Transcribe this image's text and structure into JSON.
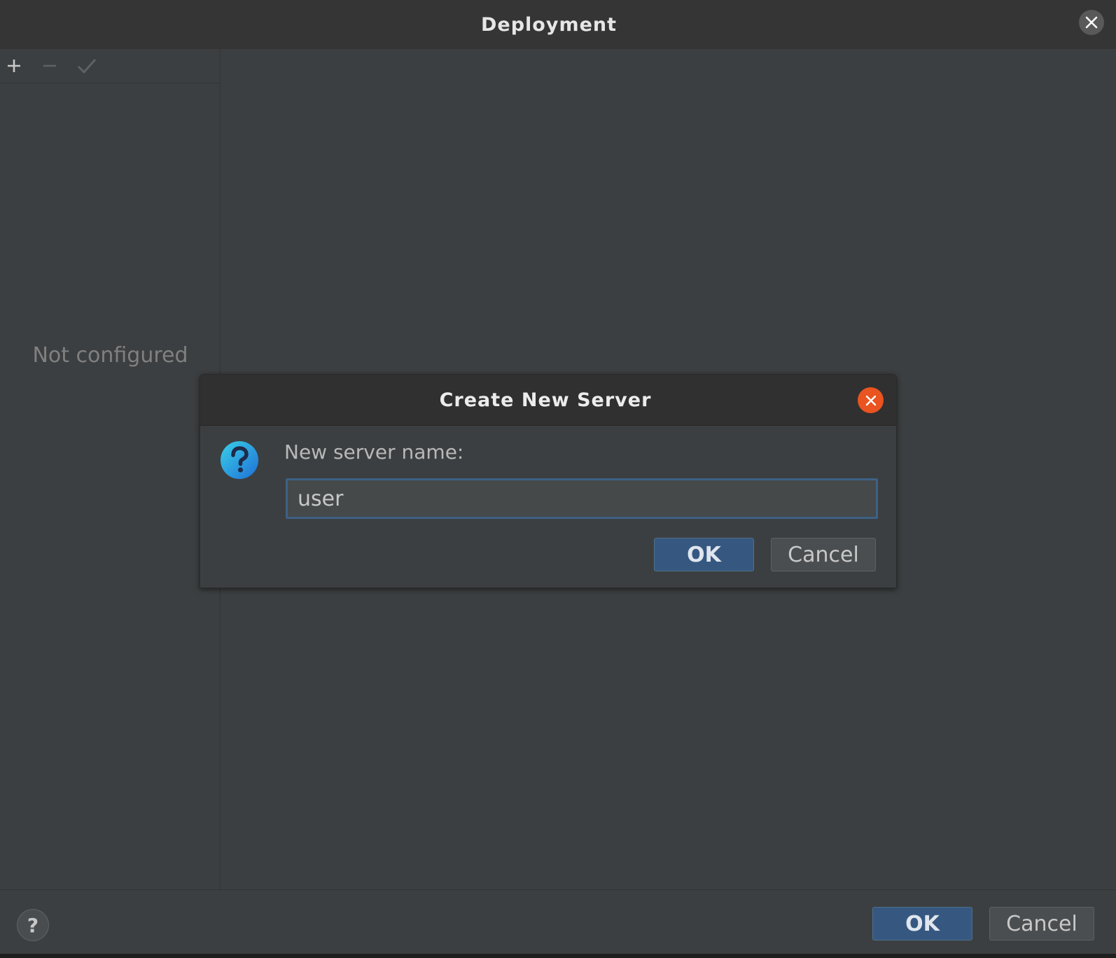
{
  "window": {
    "title": "Deployment"
  },
  "left_panel": {
    "empty_text": "Not configured",
    "toolbar": {
      "add": "+",
      "remove": "−",
      "apply": "✓"
    }
  },
  "footer": {
    "help": "?",
    "ok_label": "OK",
    "cancel_label": "Cancel"
  },
  "modal": {
    "title": "Create New Server",
    "label": "New server name:",
    "input_value": "user",
    "ok_label": "OK",
    "cancel_label": "Cancel"
  },
  "colors": {
    "accent": "#365880",
    "close_orange": "#e95420",
    "background": "#3c3f41"
  }
}
